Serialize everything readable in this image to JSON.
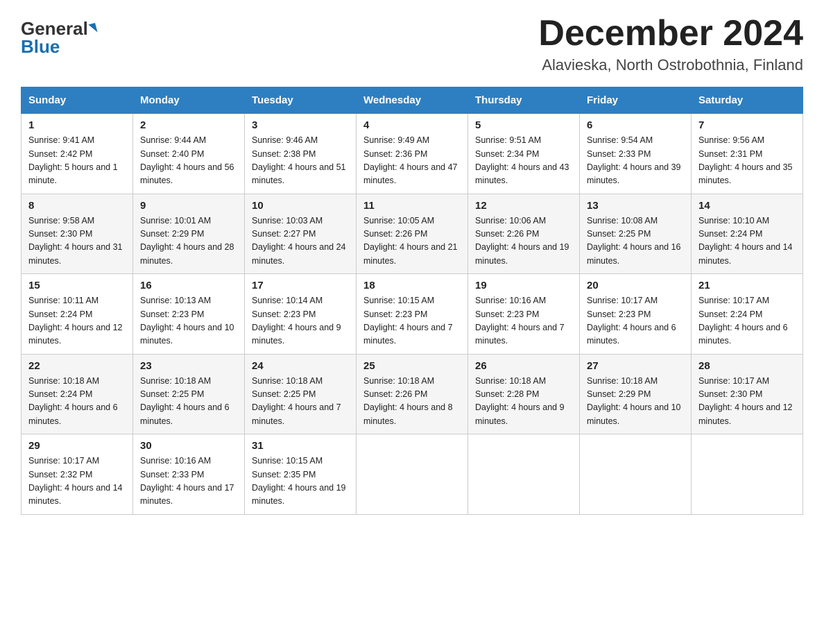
{
  "header": {
    "logo_general": "General",
    "logo_blue": "Blue",
    "month_title": "December 2024",
    "location": "Alavieska, North Ostrobothnia, Finland"
  },
  "days_of_week": [
    "Sunday",
    "Monday",
    "Tuesday",
    "Wednesday",
    "Thursday",
    "Friday",
    "Saturday"
  ],
  "weeks": [
    [
      {
        "day": "1",
        "sunrise": "9:41 AM",
        "sunset": "2:42 PM",
        "daylight": "5 hours and 1 minute."
      },
      {
        "day": "2",
        "sunrise": "9:44 AM",
        "sunset": "2:40 PM",
        "daylight": "4 hours and 56 minutes."
      },
      {
        "day": "3",
        "sunrise": "9:46 AM",
        "sunset": "2:38 PM",
        "daylight": "4 hours and 51 minutes."
      },
      {
        "day": "4",
        "sunrise": "9:49 AM",
        "sunset": "2:36 PM",
        "daylight": "4 hours and 47 minutes."
      },
      {
        "day": "5",
        "sunrise": "9:51 AM",
        "sunset": "2:34 PM",
        "daylight": "4 hours and 43 minutes."
      },
      {
        "day": "6",
        "sunrise": "9:54 AM",
        "sunset": "2:33 PM",
        "daylight": "4 hours and 39 minutes."
      },
      {
        "day": "7",
        "sunrise": "9:56 AM",
        "sunset": "2:31 PM",
        "daylight": "4 hours and 35 minutes."
      }
    ],
    [
      {
        "day": "8",
        "sunrise": "9:58 AM",
        "sunset": "2:30 PM",
        "daylight": "4 hours and 31 minutes."
      },
      {
        "day": "9",
        "sunrise": "10:01 AM",
        "sunset": "2:29 PM",
        "daylight": "4 hours and 28 minutes."
      },
      {
        "day": "10",
        "sunrise": "10:03 AM",
        "sunset": "2:27 PM",
        "daylight": "4 hours and 24 minutes."
      },
      {
        "day": "11",
        "sunrise": "10:05 AM",
        "sunset": "2:26 PM",
        "daylight": "4 hours and 21 minutes."
      },
      {
        "day": "12",
        "sunrise": "10:06 AM",
        "sunset": "2:26 PM",
        "daylight": "4 hours and 19 minutes."
      },
      {
        "day": "13",
        "sunrise": "10:08 AM",
        "sunset": "2:25 PM",
        "daylight": "4 hours and 16 minutes."
      },
      {
        "day": "14",
        "sunrise": "10:10 AM",
        "sunset": "2:24 PM",
        "daylight": "4 hours and 14 minutes."
      }
    ],
    [
      {
        "day": "15",
        "sunrise": "10:11 AM",
        "sunset": "2:24 PM",
        "daylight": "4 hours and 12 minutes."
      },
      {
        "day": "16",
        "sunrise": "10:13 AM",
        "sunset": "2:23 PM",
        "daylight": "4 hours and 10 minutes."
      },
      {
        "day": "17",
        "sunrise": "10:14 AM",
        "sunset": "2:23 PM",
        "daylight": "4 hours and 9 minutes."
      },
      {
        "day": "18",
        "sunrise": "10:15 AM",
        "sunset": "2:23 PM",
        "daylight": "4 hours and 7 minutes."
      },
      {
        "day": "19",
        "sunrise": "10:16 AM",
        "sunset": "2:23 PM",
        "daylight": "4 hours and 7 minutes."
      },
      {
        "day": "20",
        "sunrise": "10:17 AM",
        "sunset": "2:23 PM",
        "daylight": "4 hours and 6 minutes."
      },
      {
        "day": "21",
        "sunrise": "10:17 AM",
        "sunset": "2:24 PM",
        "daylight": "4 hours and 6 minutes."
      }
    ],
    [
      {
        "day": "22",
        "sunrise": "10:18 AM",
        "sunset": "2:24 PM",
        "daylight": "4 hours and 6 minutes."
      },
      {
        "day": "23",
        "sunrise": "10:18 AM",
        "sunset": "2:25 PM",
        "daylight": "4 hours and 6 minutes."
      },
      {
        "day": "24",
        "sunrise": "10:18 AM",
        "sunset": "2:25 PM",
        "daylight": "4 hours and 7 minutes."
      },
      {
        "day": "25",
        "sunrise": "10:18 AM",
        "sunset": "2:26 PM",
        "daylight": "4 hours and 8 minutes."
      },
      {
        "day": "26",
        "sunrise": "10:18 AM",
        "sunset": "2:28 PM",
        "daylight": "4 hours and 9 minutes."
      },
      {
        "day": "27",
        "sunrise": "10:18 AM",
        "sunset": "2:29 PM",
        "daylight": "4 hours and 10 minutes."
      },
      {
        "day": "28",
        "sunrise": "10:17 AM",
        "sunset": "2:30 PM",
        "daylight": "4 hours and 12 minutes."
      }
    ],
    [
      {
        "day": "29",
        "sunrise": "10:17 AM",
        "sunset": "2:32 PM",
        "daylight": "4 hours and 14 minutes."
      },
      {
        "day": "30",
        "sunrise": "10:16 AM",
        "sunset": "2:33 PM",
        "daylight": "4 hours and 17 minutes."
      },
      {
        "day": "31",
        "sunrise": "10:15 AM",
        "sunset": "2:35 PM",
        "daylight": "4 hours and 19 minutes."
      },
      null,
      null,
      null,
      null
    ]
  ]
}
